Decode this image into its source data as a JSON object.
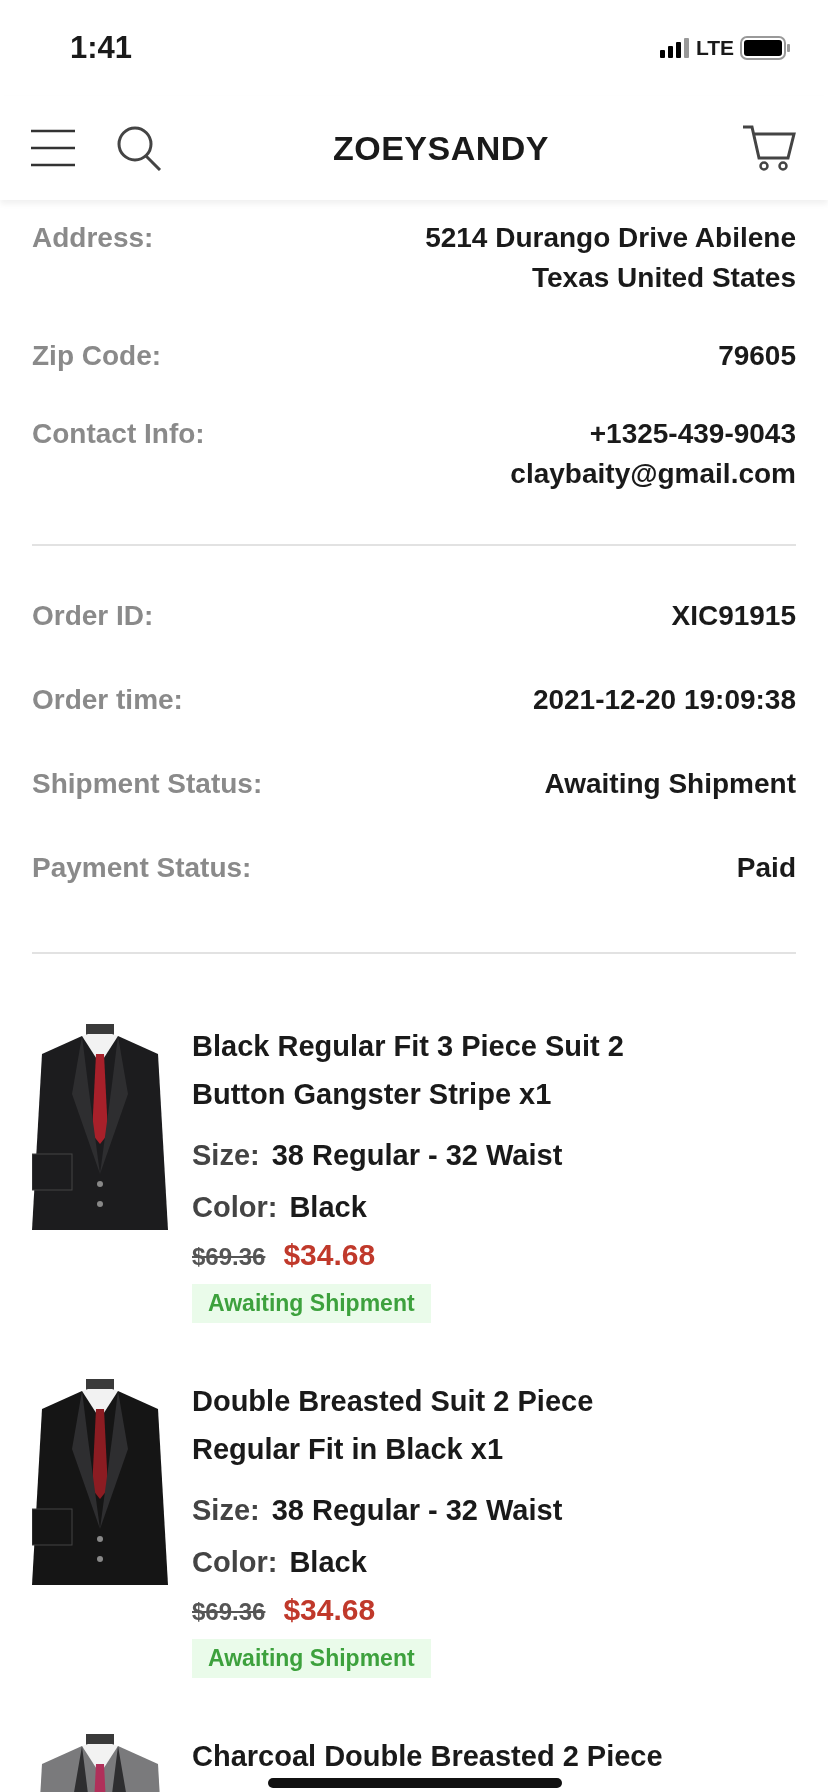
{
  "status_bar": {
    "time": "1:41",
    "network": "LTE"
  },
  "header": {
    "brand": "ZOEYSANDY"
  },
  "address_rows": [
    {
      "label": "Address:",
      "values": [
        "5214 Durango Drive Abilene Texas United States"
      ]
    },
    {
      "label": "Zip Code:",
      "values": [
        "79605"
      ]
    },
    {
      "label": "Contact Info:",
      "values": [
        "+1325-439-9043",
        "claybaity@gmail.com"
      ]
    }
  ],
  "order_rows": [
    {
      "label": "Order ID:",
      "values": [
        "XIC91915"
      ]
    },
    {
      "label": "Order time:",
      "values": [
        "2021-12-20 19:09:38"
      ]
    },
    {
      "label": "Shipment Status:",
      "values": [
        "Awaiting Shipment"
      ]
    },
    {
      "label": "Payment Status:",
      "values": [
        "Paid"
      ]
    }
  ],
  "items": [
    {
      "title": "Black Regular Fit 3 Piece Suit 2 Button Gangster Stripe x1",
      "size_label": "Size:",
      "size": "38 Regular - 32 Waist",
      "color_label": "Color:",
      "color_name": "Black",
      "original_price": "$69.36",
      "price": "$34.68",
      "status": "Awaiting Shipment"
    },
    {
      "title": "Double Breasted Suit 2 Piece Regular Fit in Black x1",
      "size_label": "Size:",
      "size": "38 Regular - 32 Waist",
      "color_label": "Color:",
      "color_name": "Black",
      "original_price": "$69.36",
      "price": "$34.68",
      "status": "Awaiting Shipment"
    },
    {
      "title": "Charcoal Double Breasted 2 Piece"
    }
  ]
}
